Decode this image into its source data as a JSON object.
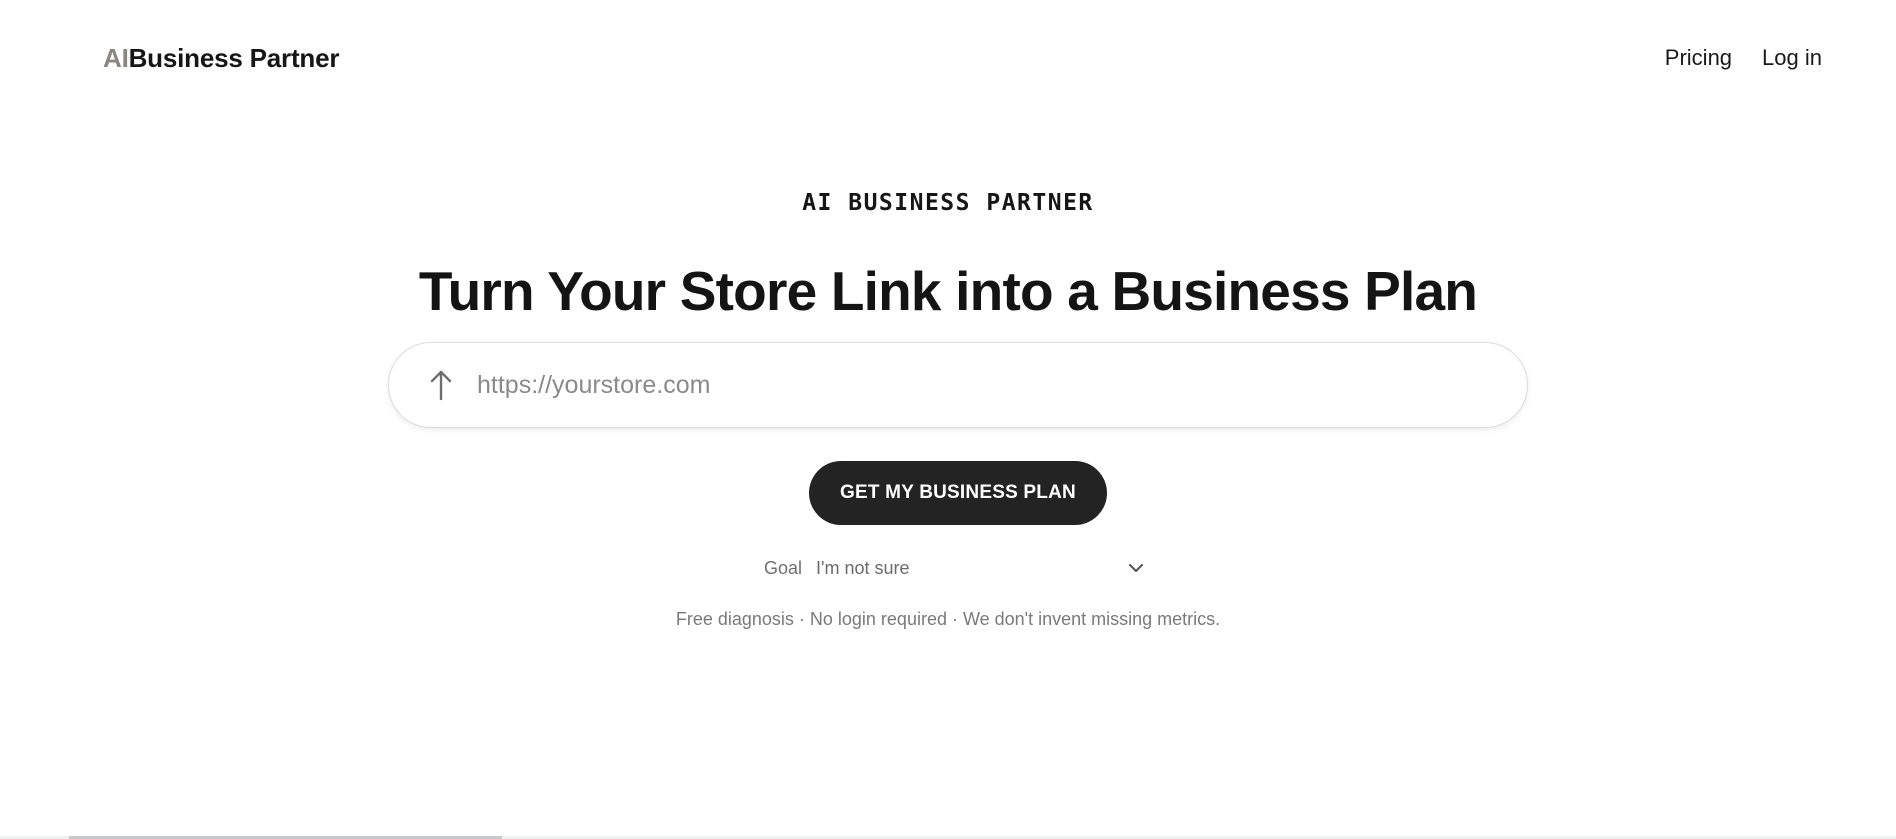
{
  "header": {
    "logo_prefix": "AI",
    "logo_main": "Business Partner",
    "nav": {
      "pricing": "Pricing",
      "login": "Log in"
    }
  },
  "hero": {
    "eyebrow": "AI BUSINESS PARTNER",
    "headline": "Turn Your Store Link into a Business Plan"
  },
  "url_input": {
    "placeholder": "https://yourstore.com",
    "value": "",
    "icon": "upload-arrow-icon"
  },
  "cta": {
    "label": "GET MY BUSINESS PLAN"
  },
  "goal": {
    "label": "Goal",
    "selected": "I'm not sure",
    "icon": "chevron-down-icon"
  },
  "note": "Free diagnosis · No login required · We don't invent missing metrics.",
  "colors": {
    "background": "#ffffff",
    "text": "#1a1a1a",
    "button": "#232323",
    "muted": "#7a7a7a",
    "logo_prefix": "#8a8682"
  }
}
